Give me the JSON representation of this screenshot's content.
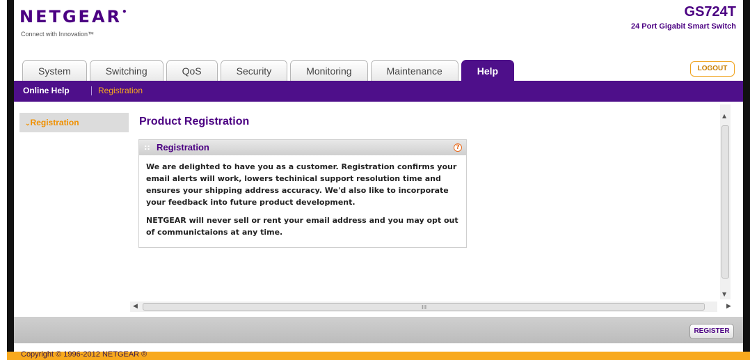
{
  "header": {
    "logo": "NETGEAR",
    "tagline": "Connect with Innovation™",
    "model": "GS724T",
    "model_desc": "24 Port Gigabit Smart Switch",
    "logout_label": "LOGOUT"
  },
  "tabs": [
    {
      "label": "System",
      "active": false
    },
    {
      "label": "Switching",
      "active": false
    },
    {
      "label": "QoS",
      "active": false
    },
    {
      "label": "Security",
      "active": false
    },
    {
      "label": "Monitoring",
      "active": false
    },
    {
      "label": "Maintenance",
      "active": false
    },
    {
      "label": "Help",
      "active": true
    }
  ],
  "subnav": {
    "online_help": "Online Help",
    "registration": "Registration"
  },
  "sidebar": {
    "items": [
      {
        "label": "Registration",
        "icon": "chevron-down-icon",
        "active": true
      }
    ]
  },
  "main": {
    "page_title": "Product Registration",
    "panel": {
      "title": "Registration",
      "help_icon": "?",
      "paragraphs": [
        "We are delighted to have you as a customer. Registration confirms your email alerts will work, lowers techinical support resolution time and ensures your shipping address accuracy. We'd also like to incorporate your feedback into future product development.",
        "NETGEAR will never sell or rent your email address and you may opt out of communictaions at any time."
      ]
    }
  },
  "actions": {
    "register_label": "REGISTER"
  },
  "footer": {
    "copyright": "Copyright © 1996-2012 NETGEAR ®"
  },
  "colors": {
    "brand_purple": "#4e0f8a",
    "accent_orange": "#f8a91d"
  }
}
